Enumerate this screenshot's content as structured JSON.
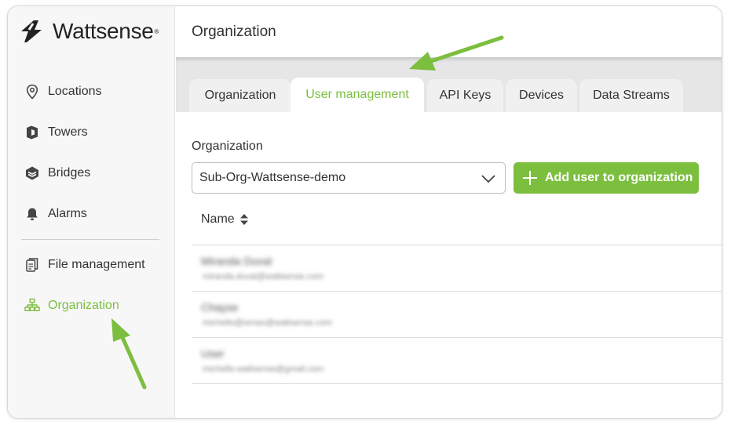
{
  "brand": {
    "name": "Wattsense",
    "reg": "®",
    "accent": "#7cbf3f"
  },
  "sidebar": {
    "items": [
      {
        "label": "Locations",
        "icon": "location-pin-icon"
      },
      {
        "label": "Towers",
        "icon": "tower-icon"
      },
      {
        "label": "Bridges",
        "icon": "bridge-icon"
      },
      {
        "label": "Alarms",
        "icon": "bell-icon"
      },
      {
        "label": "File management",
        "icon": "files-icon"
      },
      {
        "label": "Organization",
        "icon": "org-chart-icon",
        "active": true
      }
    ]
  },
  "header": {
    "title": "Organization"
  },
  "tabs": [
    {
      "label": "Organization"
    },
    {
      "label": "User management",
      "active": true
    },
    {
      "label": "API Keys"
    },
    {
      "label": "Devices"
    },
    {
      "label": "Data Streams"
    }
  ],
  "form": {
    "org_label": "Organization",
    "org_select_value": "Sub-Org-Wattsense-demo",
    "add_button_label": "Add user to organization"
  },
  "table": {
    "column_name": "Name",
    "rows": [
      {
        "name": "Miranda Duval",
        "email": "miranda.duval@wattsense.com"
      },
      {
        "name": "Chayse",
        "email": "michelle@ixmax@wattsense.com"
      },
      {
        "name": "User",
        "email": "michelle.wattsense@gmail.com"
      }
    ]
  }
}
